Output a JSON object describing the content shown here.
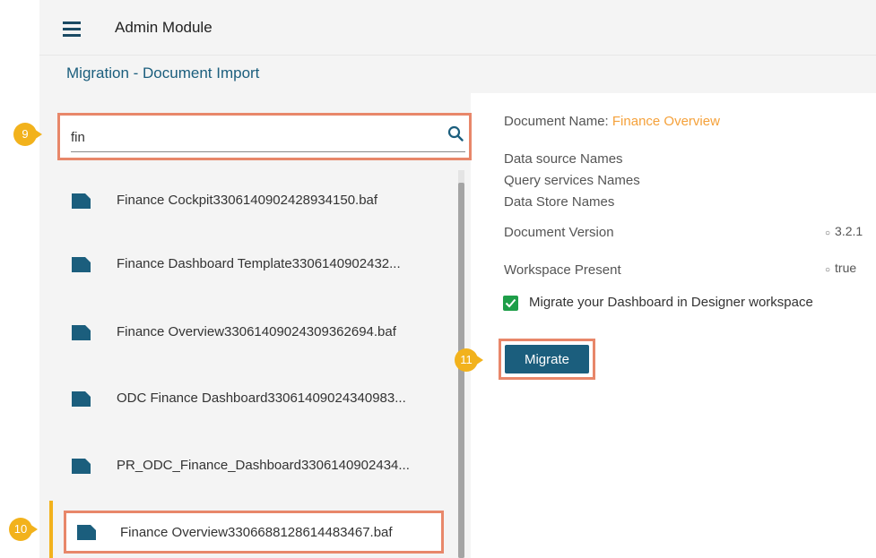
{
  "header": {
    "title": "Admin Module",
    "menu_icon": "hamburger-menu-icon"
  },
  "breadcrumb": "Migration - Document Import",
  "search": {
    "value": "fin",
    "icon": "search-icon"
  },
  "files": [
    "Finance Cockpit3306140902428934150.baf",
    "Finance Dashboard Template3306140902432...",
    "Finance Overview3306140902430936 2694.baf",
    "ODC Finance Dashboard33061409024340983...",
    "PR_ODC_Finance_Dashboard3306140902434...",
    "Finance Overview3306688128614483467.baf"
  ],
  "details": {
    "document_name_label": "Document Name:",
    "document_name_value": "Finance Overview",
    "data_source_names": "Data source Names",
    "query_services_names": "Query services Names",
    "data_store_names": "Data Store Names",
    "document_version_label": "Document Version",
    "document_version_value": "3.2.1",
    "workspace_present_label": "Workspace Present",
    "workspace_present_value": "true",
    "migrate_checkbox_label": "Migrate your Dashboard in Designer workspace",
    "migrate_checkbox_checked": true
  },
  "migrate_button": "Migrate",
  "callouts": {
    "search": "9",
    "selected_file": "10",
    "migrate": "11"
  },
  "colors": {
    "accent_orange": "#f5a13a",
    "highlight_border": "#e8876a",
    "callout_yellow": "#f2b21c",
    "primary_teal": "#1b5e7d",
    "checkbox_green": "#1e9e49"
  }
}
